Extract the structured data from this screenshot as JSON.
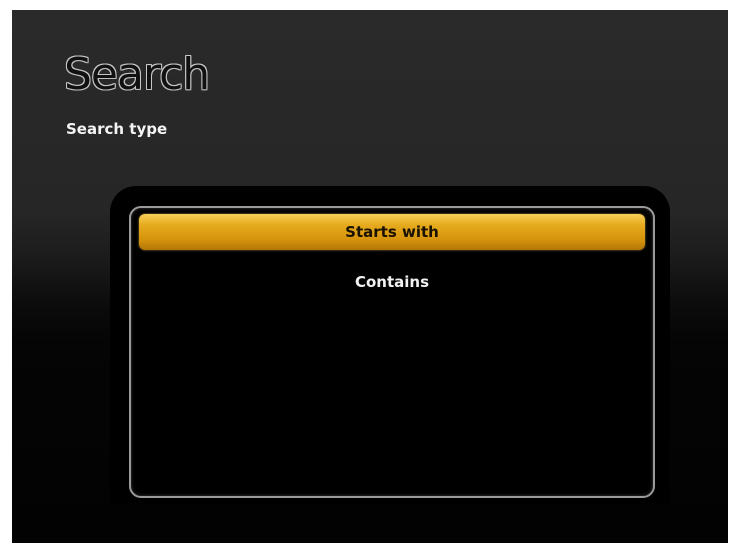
{
  "header": {
    "title": "Search",
    "subtitle": "Search type"
  },
  "menu": {
    "options": [
      {
        "label": "Starts with",
        "selected": true
      },
      {
        "label": "Contains",
        "selected": false
      }
    ]
  },
  "colors": {
    "background": "#1c1c1c",
    "highlight": "#e6ab1e",
    "panel_border": "#9a9a9a",
    "text": "#f2f2f2"
  }
}
